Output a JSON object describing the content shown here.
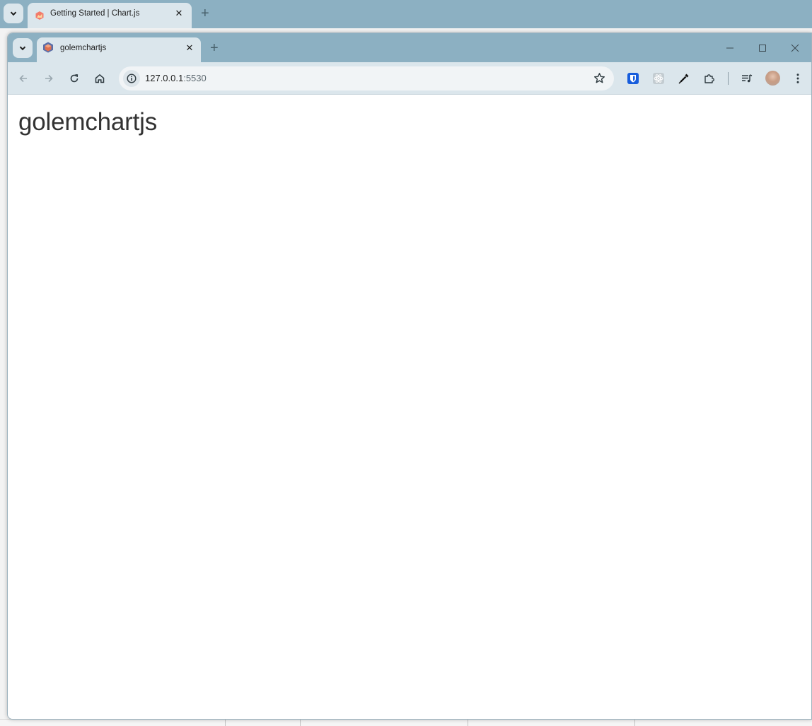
{
  "background_window": {
    "tab": {
      "title": "Getting Started | Chart.js",
      "close_glyph": "✕"
    },
    "new_tab_glyph": "+"
  },
  "window": {
    "tab": {
      "title": "golemchartjs",
      "close_glyph": "✕"
    },
    "new_tab_glyph": "+",
    "controls": {
      "minimize": "—",
      "maximize": "☐",
      "close": "✕"
    },
    "address_bar": {
      "host": "127.0.0.1",
      "port": ":5530"
    }
  },
  "page": {
    "heading": "golemchartjs"
  },
  "icons": {
    "tab_list": "chevron-down-icon",
    "back": "arrow-left-icon",
    "forward": "arrow-right-icon",
    "reload": "reload-icon",
    "home": "home-icon",
    "site_info": "info-icon",
    "bookmark": "star-icon",
    "extensions": [
      "bitwarden-icon",
      "react-devtools-icon",
      "eyedropper-icon",
      "puzzle-icon"
    ],
    "media": "media-queue-icon",
    "menu": "kebab-menu-icon"
  },
  "colors": {
    "tabstrip": "#8cb0c2",
    "toolbar": "#dbe6ec",
    "heading_text": "#333333"
  }
}
